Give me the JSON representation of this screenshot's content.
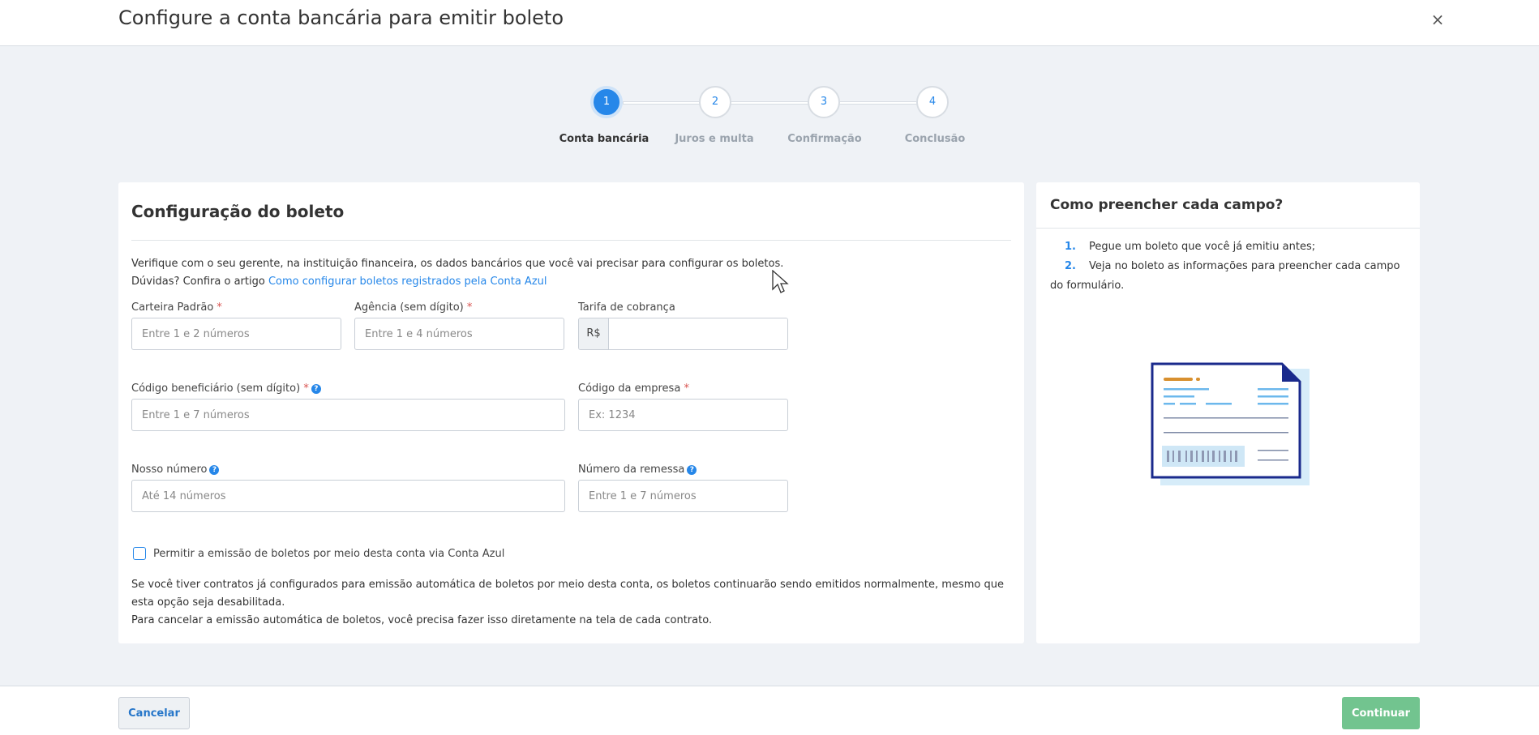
{
  "header": {
    "title": "Configure a conta bancária para emitir boleto",
    "close_label": "×"
  },
  "stepper": {
    "steps": [
      {
        "number": "1",
        "label": "Conta bancária"
      },
      {
        "number": "2",
        "label": "Juros e multa"
      },
      {
        "number": "3",
        "label": "Confirmação"
      },
      {
        "number": "4",
        "label": "Conclusão"
      }
    ]
  },
  "form": {
    "title": "Configuração do boleto",
    "intro_line1": "Verifique com o seu gerente, na instituição financeira, os dados bancários que você vai precisar para configurar os boletos.",
    "intro_line2_prefix": "Dúvidas? Confira o artigo ",
    "intro_link": "Como configurar boletos registrados pela Conta Azul",
    "required_mark": "*",
    "help_mark": "?",
    "fields": {
      "carteira": {
        "label": "Carteira Padrão",
        "placeholder": "Entre 1 e 2 números"
      },
      "agencia": {
        "label": "Agência (sem dígito)",
        "placeholder": "Entre 1 e 4 números"
      },
      "tarifa": {
        "label": "Tarifa de cobrança",
        "prefix": "R$"
      },
      "beneficiario": {
        "label": "Código beneficiário (sem dígito)",
        "placeholder": "Entre 1 e 7 números"
      },
      "empresa": {
        "label": "Código da empresa",
        "placeholder": "Ex: 1234"
      },
      "nosso_numero": {
        "label": "Nosso número",
        "placeholder": "Até 14 números"
      },
      "remessa": {
        "label": "Número da remessa",
        "placeholder": "Entre 1 e 7 números"
      }
    },
    "checkbox_label": "Permitir a emissão de boletos por meio desta conta via Conta Azul",
    "note_line1": "Se você tiver contratos já configurados para emissão automática de boletos por meio desta conta, os boletos continuarão sendo emitidos normalmente, mesmo que esta opção seja desabilitada.",
    "note_line2": "Para cancelar a emissão automática de boletos, você precisa fazer isso diretamente na tela de cada contrato."
  },
  "help_panel": {
    "title": "Como preencher cada campo?",
    "items": [
      {
        "num": "1.",
        "text": "Pegue um boleto que você já emitiu antes;"
      },
      {
        "num": "2.",
        "text": "Veja no boleto as informações para preencher cada campo do formulário."
      }
    ]
  },
  "footer": {
    "cancel_label": "Cancelar",
    "continue_label": "Continuar"
  },
  "colors": {
    "primary": "#2687e9",
    "success": "#72c48f",
    "background": "#eff2f6"
  }
}
